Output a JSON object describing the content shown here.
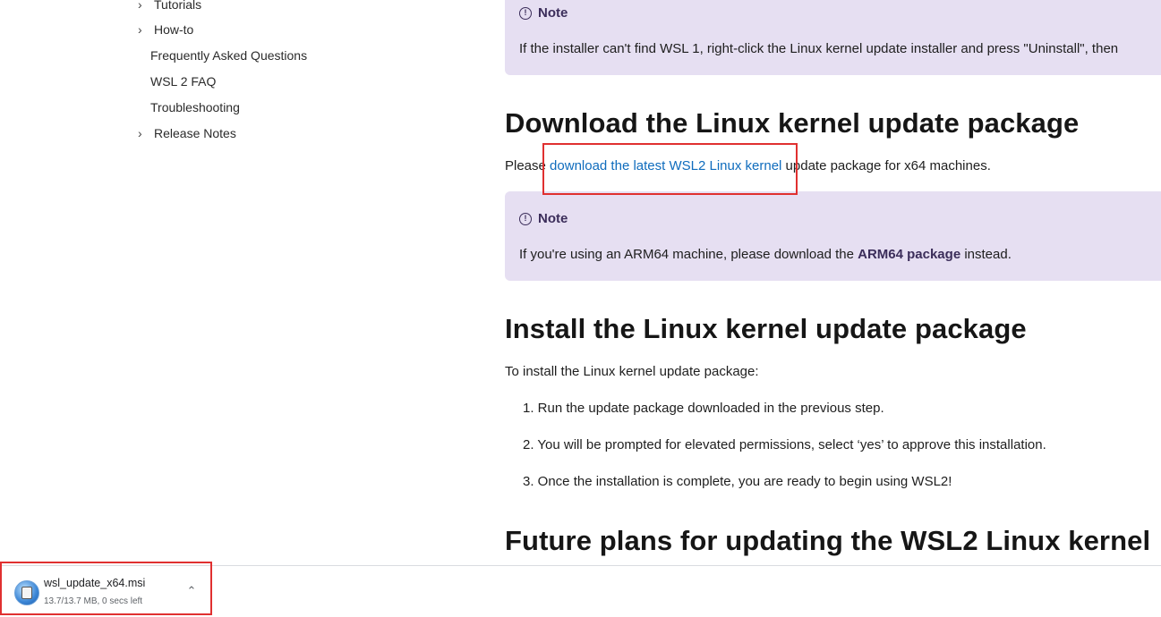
{
  "sidebar": {
    "items": [
      {
        "label": "Tutorials",
        "expandable": true
      },
      {
        "label": "How-to",
        "expandable": true
      },
      {
        "label": "Frequently Asked Questions",
        "expandable": false
      },
      {
        "label": "WSL 2 FAQ",
        "expandable": false
      },
      {
        "label": "Troubleshooting",
        "expandable": false
      },
      {
        "label": "Release Notes",
        "expandable": true
      }
    ]
  },
  "notes": [
    {
      "title": "Note",
      "text": "If the installer can't find WSL 1, right-click the Linux kernel update installer and press \"Uninstall\", then"
    },
    {
      "title": "Note",
      "text_before": "If you're using an ARM64 machine, please download the ",
      "bold": "ARM64 package",
      "text_after": " instead."
    }
  ],
  "sections": {
    "download": {
      "heading": "Download the Linux kernel update package",
      "para_before": "Please ",
      "link": "download the latest WSL2 Linux kernel",
      "para_after": " update package for x64 machines."
    },
    "install": {
      "heading": "Install the Linux kernel update package",
      "intro": "To install the Linux kernel update package:",
      "steps": [
        "1. Run the update package downloaded in the previous step.",
        "2. You will be prompted for elevated permissions, select ‘yes’ to approve this installation.",
        "3. Once the installation is complete, you are ready to begin using WSL2!"
      ]
    },
    "future": {
      "heading": "Future plans for updating the WSL2 Linux kernel"
    }
  },
  "download_bar": {
    "filename": "wsl_update_x64.msi",
    "status": "13.7/13.7 MB, 0 secs left"
  },
  "colors": {
    "note_bg": "#e6dff2",
    "link": "#0f6cbd",
    "highlight": "#e03030"
  },
  "icons": {
    "chevron": "›",
    "info": "!",
    "expand_up": "^"
  }
}
